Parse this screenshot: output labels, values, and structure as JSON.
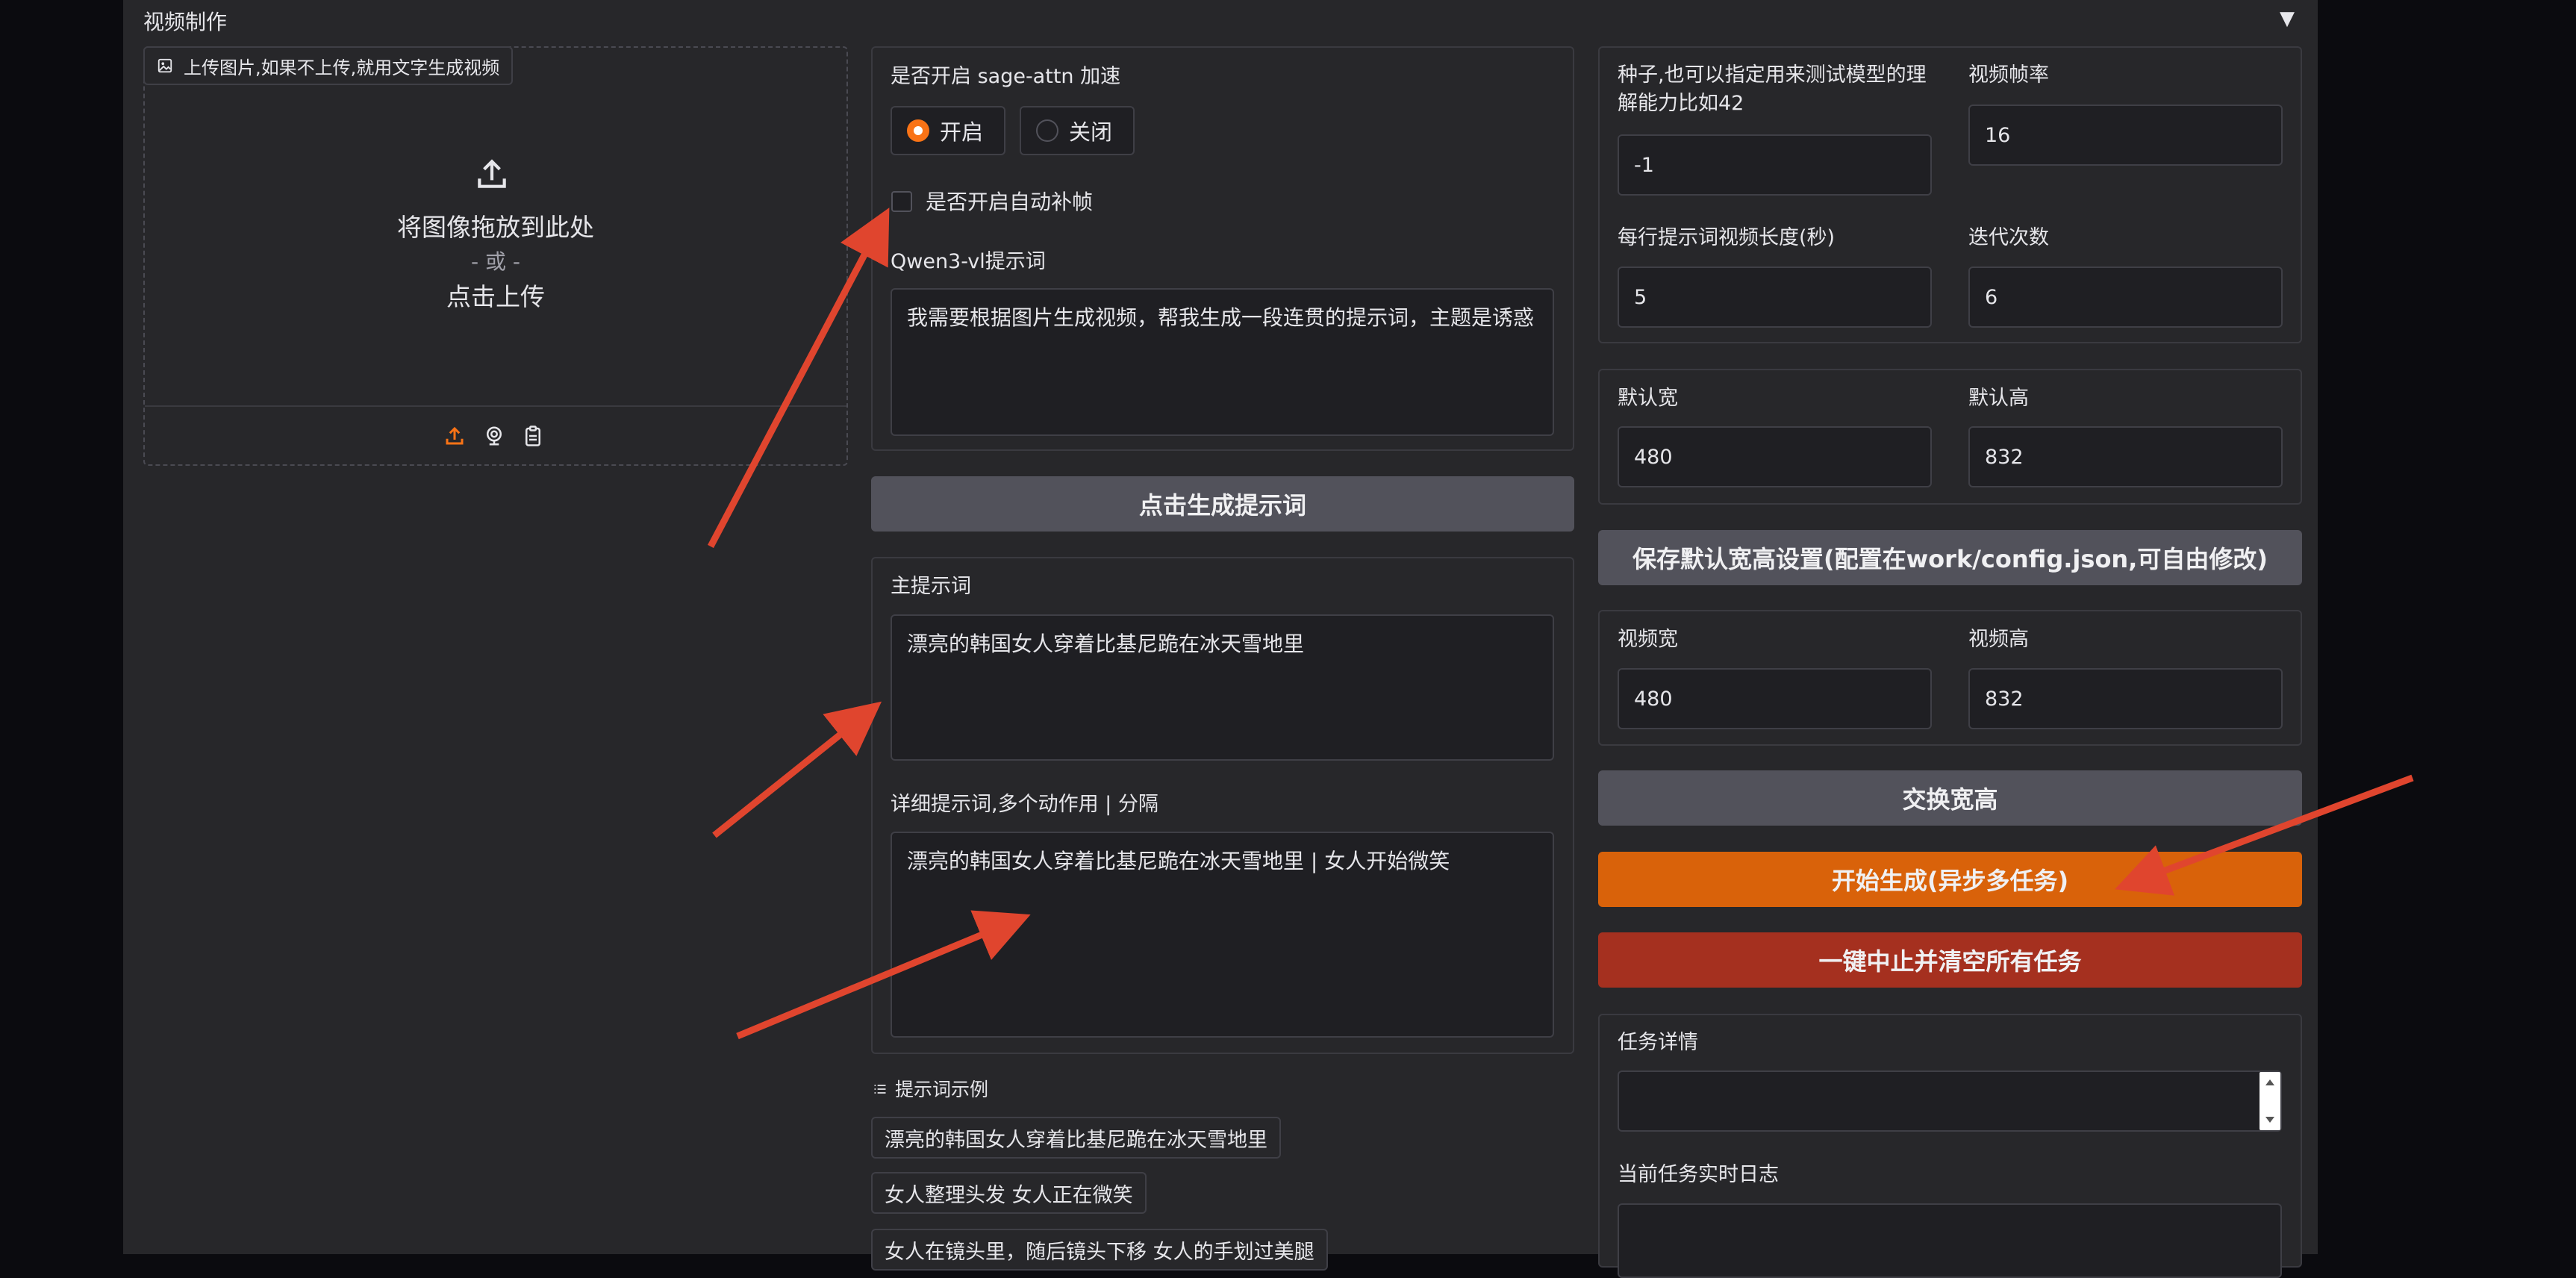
{
  "header": {
    "title": "视频制作"
  },
  "upload": {
    "chip_label": "上传图片,如果不上传,就用文字生成视频",
    "drop_text": "将图像拖放到此处",
    "or_text": "- 或 -",
    "click_text": "点击上传"
  },
  "middle": {
    "sage_label": "是否开启 sage-attn 加速",
    "radio_on": "开启",
    "radio_off": "关闭",
    "interp_label": "是否开启自动补帧",
    "qwen_label": "Qwen3-vl提示词",
    "qwen_value": "我需要根据图片生成视频，帮我生成一段连贯的提示词，主题是诱惑",
    "gen_prompt_btn": "点击生成提示词",
    "main_label": "主提示词",
    "main_value": "漂亮的韩国女人穿着比基尼跪在冰天雪地里",
    "detail_label": "详细提示词,多个动作用 | 分隔",
    "detail_value": "漂亮的韩国女人穿着比基尼跪在冰天雪地里 | 女人开始微笑",
    "examples_label": "提示词示例",
    "examples": [
      "漂亮的韩国女人穿着比基尼跪在冰天雪地里",
      "女人整理头发 女人正在微笑",
      "女人在镜头里，随后镜头下移 女人的手划过美腿"
    ]
  },
  "right": {
    "seed_label": "种子,也可以指定用来测试模型的理解能力比如42",
    "seed_value": "-1",
    "fps_label": "视频帧率",
    "fps_value": "16",
    "len_label": "每行提示词视频长度(秒)",
    "len_value": "5",
    "iter_label": "迭代次数",
    "iter_value": "6",
    "dw_label": "默认宽",
    "dw_value": "480",
    "dh_label": "默认高",
    "dh_value": "832",
    "save_btn": "保存默认宽高设置(配置在work/config.json,可自由修改)",
    "vw_label": "视频宽",
    "vw_value": "480",
    "vh_label": "视频高",
    "vh_value": "832",
    "swap_btn": "交换宽高",
    "start_btn": "开始生成(异步多任务)",
    "stop_btn": "一键中止并清空所有任务",
    "task_label": "任务详情",
    "log_label": "当前任务实时日志"
  },
  "colors": {
    "accent": "#f97316",
    "annotation": "#e0452e",
    "stop": "#a5301f"
  }
}
